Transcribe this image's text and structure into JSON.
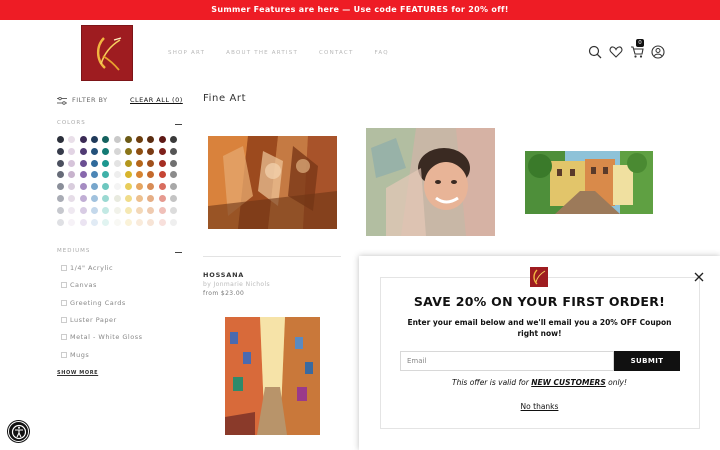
{
  "announcement": "Summer Features are here — Use code FEATURES for 20% off!",
  "nav": {
    "items": [
      {
        "label": "SHOP ART"
      },
      {
        "label": "ABOUT THE ARTIST"
      },
      {
        "label": "CONTACT"
      },
      {
        "label": "FAQ"
      }
    ]
  },
  "header_icons": {
    "search": "search-icon",
    "wishlist": "heart-icon",
    "cart": "cart-icon",
    "account": "user-icon",
    "cart_count": "0"
  },
  "filters": {
    "label": "FILTER BY",
    "clear_all": "CLEAR ALL (0)",
    "colors_title": "COLORS",
    "mediums_title": "MEDIUMS",
    "mediums": [
      {
        "label": "1/4\" Acrylic"
      },
      {
        "label": "Canvas"
      },
      {
        "label": "Greeting Cards"
      },
      {
        "label": "Luster Paper"
      },
      {
        "label": "Metal - White Gloss"
      },
      {
        "label": "Mugs"
      }
    ],
    "show_more": "SHOW MORE",
    "swatch_columns": [
      [
        "#2b2f3a",
        "#363b4a",
        "#4a4f5e",
        "#666b78",
        "#8a8e99",
        "#a9acb5",
        "#c6c8ce",
        "#dfe0e4"
      ],
      [
        "#e9dfe9",
        "#e2d4e4",
        "#d6c4da",
        "#c8b3cd",
        "#d9cddd",
        "#e6dde8",
        "#efe9f1",
        "#f6f2f7"
      ],
      [
        "#3b2a55",
        "#503b73",
        "#6a4e92",
        "#8868ad",
        "#a58cc2",
        "#c1aed5",
        "#d8cce4",
        "#ebe4f2"
      ],
      [
        "#1f3a5a",
        "#24517a",
        "#2f6a9b",
        "#4c86b6",
        "#77a6cc",
        "#a1c2de",
        "#c4d8eb",
        "#e1ebf5"
      ],
      [
        "#14615e",
        "#137a74",
        "#1b978f",
        "#3fb1a8",
        "#6dc7bf",
        "#9bd9d2",
        "#c3e9e4",
        "#e1f4f1"
      ],
      [
        "#c9c9c9",
        "#d6d6d6",
        "#e3e3e3",
        "#eeeeee",
        "#f4f4f4",
        "#e8eadf",
        "#f1f2ea",
        "#f8f8f4"
      ],
      [
        "#6b5a16",
        "#8a7519",
        "#b3971d",
        "#d8b52c",
        "#e8cd5b",
        "#f0dc8a",
        "#f5e8b3",
        "#faf2d8"
      ],
      [
        "#6d3e0e",
        "#8e4f12",
        "#b5661a",
        "#d68432",
        "#e5a561",
        "#edc08e",
        "#f3d8b8",
        "#f9ebdb"
      ],
      [
        "#5a2c10",
        "#7a3b14",
        "#a0501c",
        "#c4692b",
        "#d88c56",
        "#e6ae85",
        "#efcbb0",
        "#f7e4d6"
      ],
      [
        "#5e1815",
        "#7e211b",
        "#a52e23",
        "#c64535",
        "#d86d5f",
        "#e69a90",
        "#f0c0b9",
        "#f8e0dc"
      ],
      [
        "#3a3a3a",
        "#555555",
        "#707070",
        "#8c8c8c",
        "#a8a8a8",
        "#c4c4c4",
        "#dcdcdc",
        "#efefef"
      ]
    ]
  },
  "page_title": "Fine Art",
  "products": [
    {
      "name": "HOSSANA",
      "artist": "by Jonmarie Nichols",
      "price": "from $23.00"
    }
  ],
  "popup": {
    "title": "SAVE 20% ON YOUR FIRST ORDER!",
    "description": "Enter your email below and we'll email you a 20% OFF Coupon right now!",
    "email_placeholder": "Email",
    "submit": "SUBMIT",
    "offer_prefix": "This offer is valid for ",
    "offer_highlight": "NEW CUSTOMERS",
    "offer_suffix": " only!",
    "no_thanks": "No thanks"
  },
  "accessibility": "accessibility-icon"
}
